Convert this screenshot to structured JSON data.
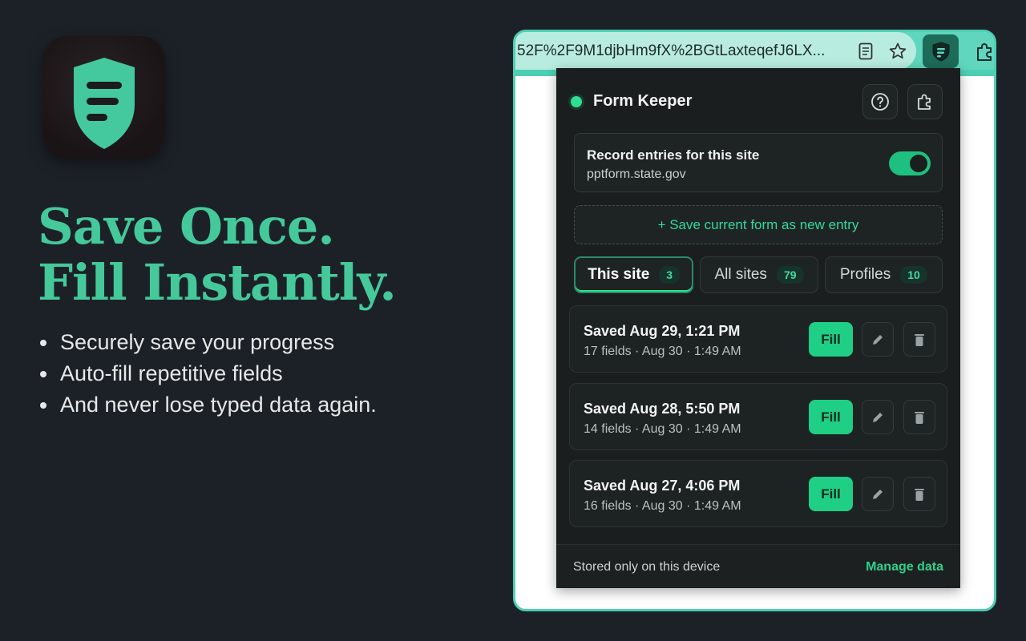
{
  "app": {
    "icon_name": "shield-form-icon",
    "accent_color": "#45c99a"
  },
  "hero": {
    "headline_line1": "Save Once.",
    "headline_line2": "Fill Instantly.",
    "bullets": [
      "Securely save your progress",
      "Auto-fill repetitive fields",
      "And never lose typed data again."
    ]
  },
  "browser": {
    "url": "52F%2F9M1djbHm9fX%2BGtLaxteqefJ6LX...",
    "icons": [
      "reader-mode-icon",
      "star-icon",
      "form-keeper-extension-icon",
      "puzzle-icon"
    ]
  },
  "popup": {
    "title": "Form Keeper",
    "status_color": "#2ee08f",
    "record": {
      "title": "Record entries for this site",
      "site": "pptform.state.gov",
      "enabled": true
    },
    "save_button": "+ Save current form as new entry",
    "tabs": [
      {
        "label": "This site",
        "count": "3",
        "active": true
      },
      {
        "label": "All sites",
        "count": "79",
        "active": false
      },
      {
        "label": "Profiles",
        "count": "10",
        "active": false
      }
    ],
    "entries": [
      {
        "title": "Saved Aug 29, 1:21 PM",
        "meta": "17 fields · Aug 30 · 1:49 AM",
        "fill_label": "Fill"
      },
      {
        "title": "Saved Aug 28, 5:50 PM",
        "meta": "14 fields · Aug 30 · 1:49 AM",
        "fill_label": "Fill"
      },
      {
        "title": "Saved Aug 27, 4:06 PM",
        "meta": "16 fields · Aug 30 · 1:49 AM",
        "fill_label": "Fill"
      }
    ],
    "footer_note": "Stored only on this device",
    "footer_link": "Manage data"
  }
}
